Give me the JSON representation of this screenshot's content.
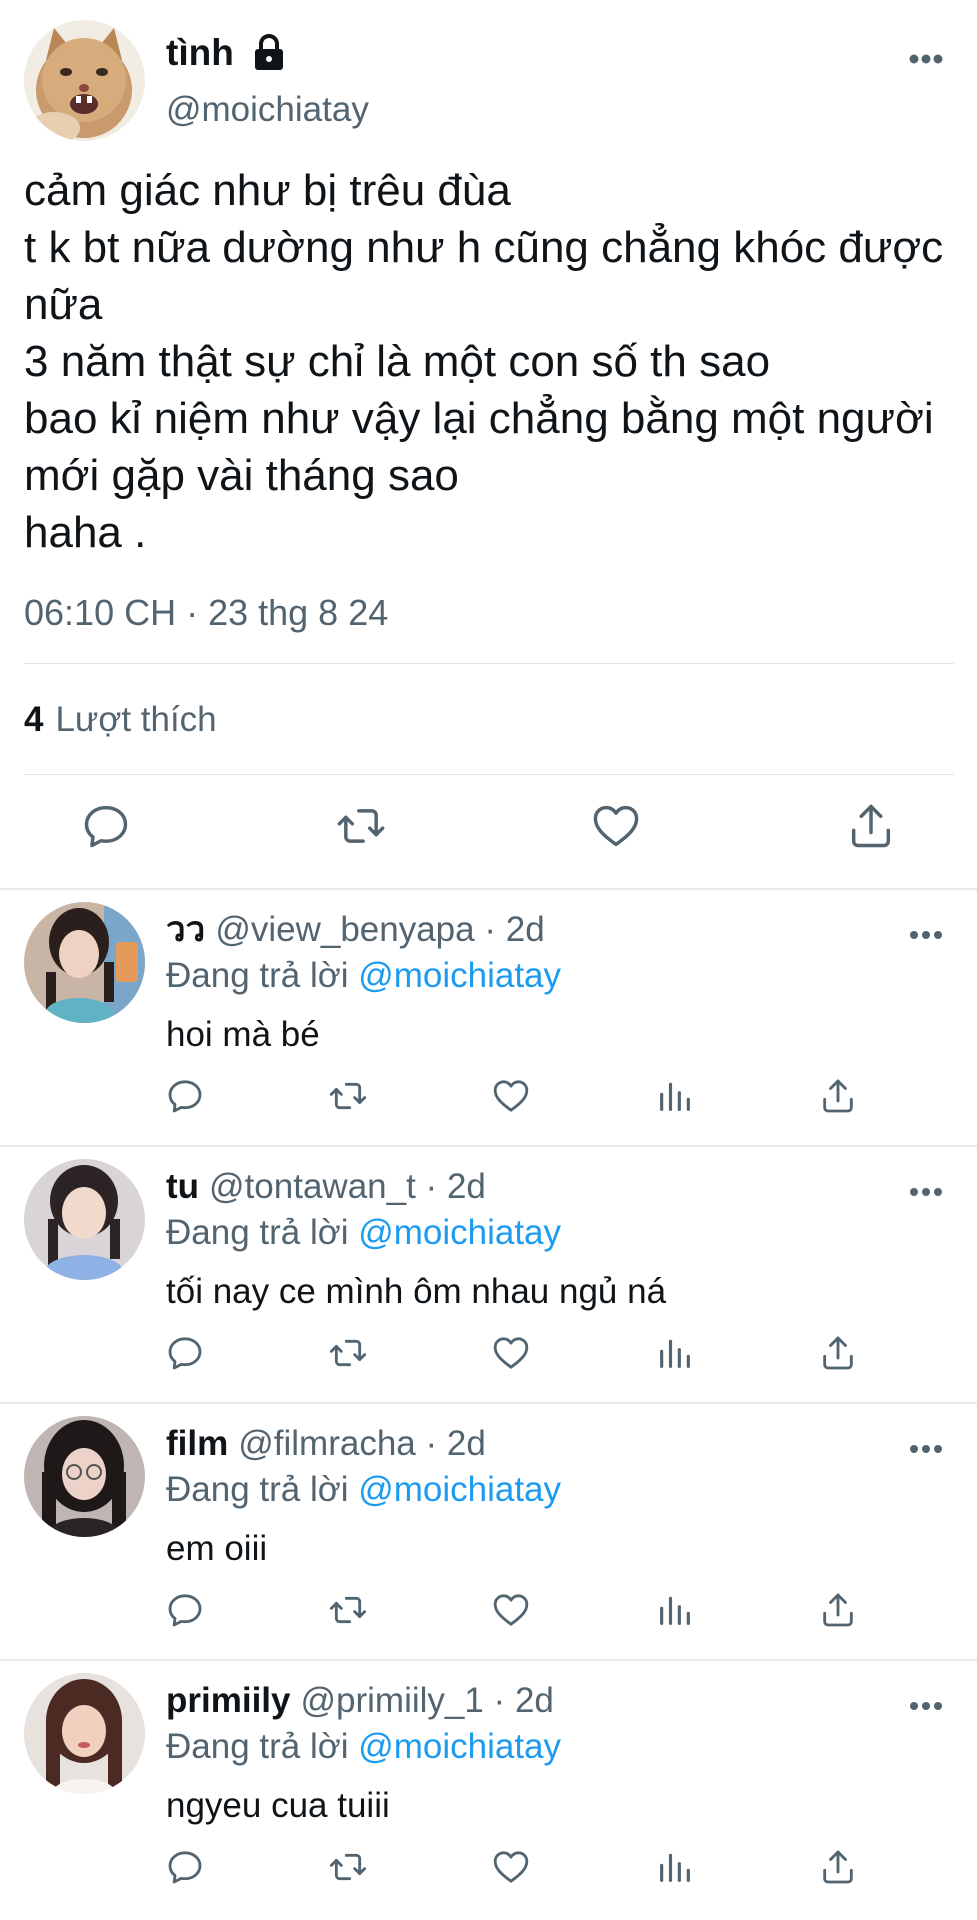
{
  "main_tweet": {
    "display_name": "tình",
    "handle": "@moichiatay",
    "protected_icon": "lock-icon",
    "text": "cảm giác như bị trêu đùa\nt k bt nữa dường như h cũng chẳng khóc được nữa\n3 năm thật sự chỉ là một con số th sao\nbao kỉ niệm như vậy lại chẳng bằng một người mới gặp vài tháng sao\nhaha .",
    "timestamp": "06:10 CH · 23 thg 8 24",
    "likes_count": "4",
    "likes_label": "Lượt thích",
    "actions": [
      "reply-icon",
      "retweet-icon",
      "like-icon",
      "share-icon"
    ]
  },
  "replies": [
    {
      "display_name": "วว",
      "handle": "@view_benyapa",
      "time": "2d",
      "replying_prefix": "Đang trả lời",
      "replying_to": "@moichiatay",
      "text": "hoi mà bé",
      "avatar_color": "#6b4a3a"
    },
    {
      "display_name": "tu",
      "handle": "@tontawan_t",
      "time": "2d",
      "replying_prefix": "Đang trả lời",
      "replying_to": "@moichiatay",
      "text": "tối nay ce mình ôm nhau ngủ ná",
      "avatar_color": "#8a7f86"
    },
    {
      "display_name": "film",
      "handle": "@filmracha",
      "time": "2d",
      "replying_prefix": "Đang trả lời",
      "replying_to": "@moichiatay",
      "text": "em oiii",
      "avatar_color": "#3a3032"
    },
    {
      "display_name": "primiily",
      "handle": "@primiily_1",
      "time": "2d",
      "replying_prefix": "Đang trả lời",
      "replying_to": "@moichiatay",
      "text": "ngyeu cua tuiii",
      "avatar_color": "#5a3a30"
    }
  ],
  "colors": {
    "text": "#0f1419",
    "muted": "#536471",
    "link": "#1d9bf0",
    "divider": "#e1e6ea"
  }
}
